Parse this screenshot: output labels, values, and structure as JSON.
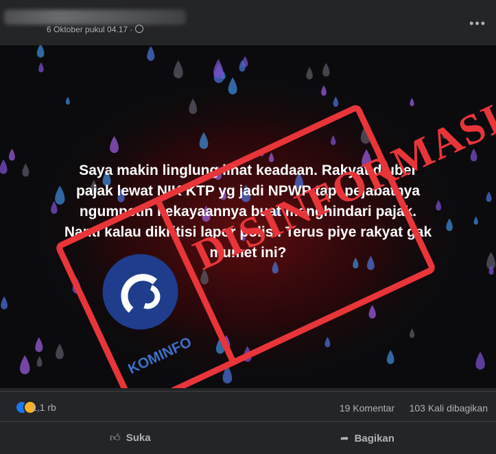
{
  "post": {
    "timestamp": "6 Oktober pukul 04.17 ·",
    "more_label": "•••"
  },
  "media": {
    "text_lines": [
      "Saya makin linglung lihat keadaan. Rakyat diuber",
      "pajak lewat NIK KTP yg jadi NPWP tapi pejabatnya",
      "ngumpetin kekayaannya buat menghindari pajak.",
      "Nanti kalau dikritisi lapor polisi. Terus piye rakyat gak",
      "mumet ini?"
    ],
    "stamp_text": "DISINFORMASI",
    "logo_text": "KOMINFO"
  },
  "stats": {
    "reaction_count": "1,1 rb",
    "comments": "19 Komentar",
    "shares": "103 Kali dibagikan"
  },
  "actions": {
    "like_label": "Suka",
    "share_label": "Bagikan"
  },
  "colors": {
    "background": "#242526",
    "stamp": "#e8353a",
    "kominfo_blue": "#1f3d8c"
  }
}
